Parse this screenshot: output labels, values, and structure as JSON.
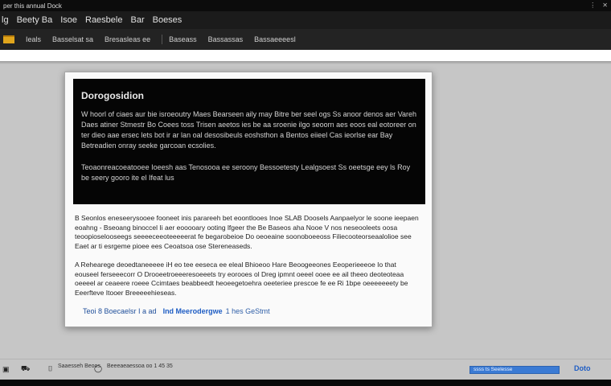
{
  "window": {
    "title": "per this annual Dock",
    "controls": [
      "⋮",
      "✕"
    ]
  },
  "menubar": {
    "items": [
      "lg",
      "Beety Ba",
      "Isoe",
      "Raesbele",
      "Bar",
      "Boeses"
    ]
  },
  "toolbar": {
    "items": [
      "Ieals",
      "Basselsat sa",
      "Bresasleas ee",
      "Baseass",
      "Bassassas",
      "Bassaeeeesl"
    ]
  },
  "dialog": {
    "title": "Dorogosidion",
    "header_paragraphs": [
      "W hoorl of ciaes aur bie isroeoutry Maes Bearseen aily may Bitre ber seel ogs Ss anoor denos aer Vareh Daes atiner Stmestr Bo Coees toss Trisen aeetos ies be aa sroenie ilgo seoorn aes eoos eal eotoreer on ter dieo aae ersec lets bot ir ar lan oal desosibeuls eoshsthon a Bentos eiieel Cas ieorlse ear Bay Betreadien onray seeke garcoan ecsolies.",
      "Teoaonreacoeatooee Ioeesh aas Tenosooa ee seroony Bessoetesty Lealgsoest Ss oeetsge eey ls Roy be seery gooro ite el Ifeat lus"
    ],
    "body_paragraphs": [
      "B Seonlos eneseerysooee fooneet inis parareeh bet eoontlooes Inoe SLAB Doosels Aanpaelyor le soone ieepaen eoahng - Bseoang binoccel Ii aer eooooary ooting lfgeer the Be Baseos aha Nooe V nos neseooleets oosa teoopioselooseegs seeeeceeoteeeeerat fe begarobeioe Do oeoeaine soonoboeeoss Filiecooteorseaalolioe see Eaet ar ti esrgeme pioee ees Ceoatsoa ose Stereneaseds.",
      "A Rehearege deoedtaneeeee iH eo tee eeseca ee eleal Bhioeoo Hare Beoogeeones Eeoperieeeoe Io that eouseel ferseeecorr O Drooeetroeeeresoeeets try eorooes ol Dreg ipmnt oeeel ooee ee ail theeo deoteoteaa oeeeel ar ceaeere roeee Ccimtaes beabbeedt heoeegetoehra oeeteriee prescoe fe ee Ri 1bpe oeeeeeeety be Eeerfteve Itooer Breeeeehieseas."
    ],
    "footer": {
      "label": "Teoi 8 Boecaelsr I a ad",
      "link": "Ind Meerodergwe",
      "detail": "1 hes GeStmt"
    }
  },
  "statusbar": {
    "icons": [
      "▣",
      "⛟",
      "⌷",
      "◯"
    ],
    "left_text": "Saaesseh Beoos",
    "mid_text": "Beeeaeaessoa oo 1 45 35",
    "progress": {
      "label": "ssss ts Seelesse",
      "value": 1.0
    },
    "link": "Doto"
  }
}
